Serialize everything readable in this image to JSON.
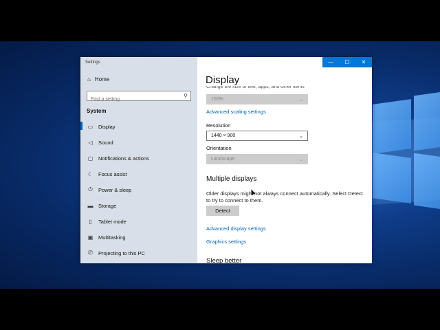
{
  "window": {
    "title": "Settings",
    "controls": {
      "minimize": "—",
      "maximize": "☐",
      "close": "✕"
    }
  },
  "sidebar": {
    "home": {
      "label": "Home",
      "icon": "home-icon"
    },
    "search": {
      "placeholder": "Find a setting",
      "icon": "search-icon"
    },
    "section": "System",
    "items": [
      {
        "label": "Display",
        "icon": "display-icon"
      },
      {
        "label": "Sound",
        "icon": "sound-icon"
      },
      {
        "label": "Notifications & actions",
        "icon": "notifications-icon"
      },
      {
        "label": "Focus assist",
        "icon": "focus-assist-icon"
      },
      {
        "label": "Power & sleep",
        "icon": "power-icon"
      },
      {
        "label": "Storage",
        "icon": "storage-icon"
      },
      {
        "label": "Tablet mode",
        "icon": "tablet-icon"
      },
      {
        "label": "Multitasking",
        "icon": "multitasking-icon"
      },
      {
        "label": "Projecting to this PC",
        "icon": "projecting-icon"
      }
    ],
    "active": "Display"
  },
  "content": {
    "title": "Display",
    "clipped_text": "Change the size of text, apps, and other items",
    "scale_value": "150%",
    "advanced_scaling_link": "Advanced scaling settings",
    "resolution": {
      "label": "Resolution",
      "value": "1440 × 900"
    },
    "orientation": {
      "label": "Orientation",
      "value": "Landscape"
    },
    "multiple_displays": {
      "heading": "Multiple displays",
      "description": "Older displays might not always connect automatically. Select Detect to try to connect to them.",
      "detect_button": "Detect"
    },
    "advanced_display_link": "Advanced display settings",
    "graphics_link": "Graphics settings",
    "sleep_heading": "Sleep better"
  },
  "colors": {
    "accent": "#0078d7",
    "link": "#0063b1",
    "sidebar": "#d9dfe8"
  }
}
